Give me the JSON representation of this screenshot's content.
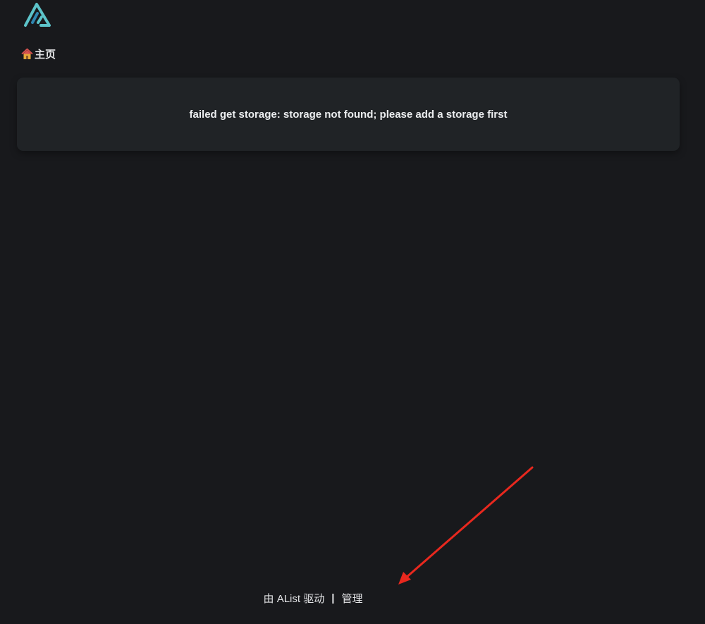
{
  "header": {
    "logo_icon": "alist-logo-icon"
  },
  "breadcrumb": {
    "home_icon": "home-icon",
    "home_label": "主页"
  },
  "error": {
    "message": "failed get storage: storage not found; please add a storage first"
  },
  "footer": {
    "powered_by": "由 AList 驱动",
    "separator": "|",
    "manage_label": "管理"
  },
  "annotation": {
    "arrow_color": "#e8281e"
  },
  "colors": {
    "background": "#18191c",
    "card": "#202326",
    "logo_accent": "#4fb3bf",
    "logo_dark": "#2f7fa3"
  }
}
